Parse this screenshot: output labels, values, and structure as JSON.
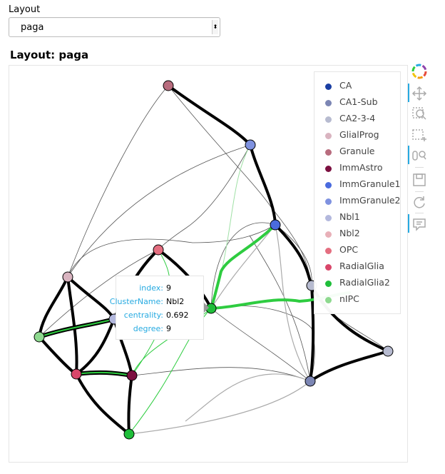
{
  "layout_widget": {
    "label": "Layout",
    "selected": "paga",
    "arrow": "⬍"
  },
  "plot": {
    "title": "Layout: paga"
  },
  "legend": {
    "items": [
      {
        "label": "CA",
        "color": "#1a3fa3"
      },
      {
        "label": "CA1-Sub",
        "color": "#7c86b4"
      },
      {
        "label": "CA2-3-4",
        "color": "#b7bbd0"
      },
      {
        "label": "GlialProg",
        "color": "#d9b4c0"
      },
      {
        "label": "Granule",
        "color": "#b86c7e"
      },
      {
        "label": "ImmAstro",
        "color": "#7c1040"
      },
      {
        "label": "ImmGranule1",
        "color": "#4a6bde"
      },
      {
        "label": "ImmGranule2",
        "color": "#7f92e0"
      },
      {
        "label": "Nbl1",
        "color": "#b3b8dd"
      },
      {
        "label": "Nbl2",
        "color": "#e8b0b8"
      },
      {
        "label": "OPC",
        "color": "#e46e80"
      },
      {
        "label": "RadialGlia",
        "color": "#d9466a"
      },
      {
        "label": "RadialGlia2",
        "color": "#1fbe3a"
      },
      {
        "label": "nIPC",
        "color": "#8ed98f"
      }
    ]
  },
  "tooltip": {
    "rows": [
      {
        "key": "index:",
        "value": "9"
      },
      {
        "key": "ClusterName:",
        "value": "Nbl2"
      },
      {
        "key": "centrality:",
        "value": "0.692"
      },
      {
        "key": "degree:",
        "value": "9"
      }
    ]
  },
  "toolbar": {
    "tools": [
      {
        "name": "bokeh-logo-icon"
      },
      {
        "name": "pan-icon"
      },
      {
        "name": "box-zoom-icon"
      },
      {
        "name": "box-select-icon"
      },
      {
        "name": "wheel-zoom-icon"
      },
      {
        "name": "save-icon"
      },
      {
        "name": "reset-icon"
      },
      {
        "name": "hover-icon"
      }
    ]
  },
  "colors": {
    "highlight_edge": "#2ecc40",
    "tool_active": "#26aae1",
    "tooltip_key": "#26aae1"
  }
}
